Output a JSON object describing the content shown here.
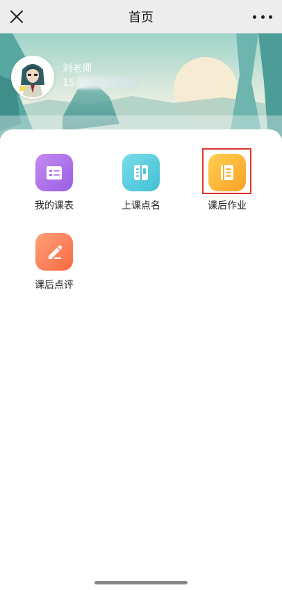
{
  "header": {
    "title": "首页"
  },
  "profile": {
    "name": "刘老师",
    "phone_prefix": "15"
  },
  "menu": [
    {
      "label": "我的课表",
      "icon": "schedule-icon",
      "color_from": "#c48af2",
      "color_to": "#9a5ee3"
    },
    {
      "label": "上课点名",
      "icon": "roll-call-icon",
      "color_from": "#79dde8",
      "color_to": "#43bfd6"
    },
    {
      "label": "课后作业",
      "icon": "homework-icon",
      "color_from": "#ffcf52",
      "color_to": "#fba126",
      "selected": true
    },
    {
      "label": "课后点评",
      "icon": "review-pencil-icon",
      "color_from": "#ffa07a",
      "color_to": "#f86a42"
    }
  ],
  "colors": {
    "highlight_border": "#e0332e",
    "topbar_bg": "#ededed"
  }
}
